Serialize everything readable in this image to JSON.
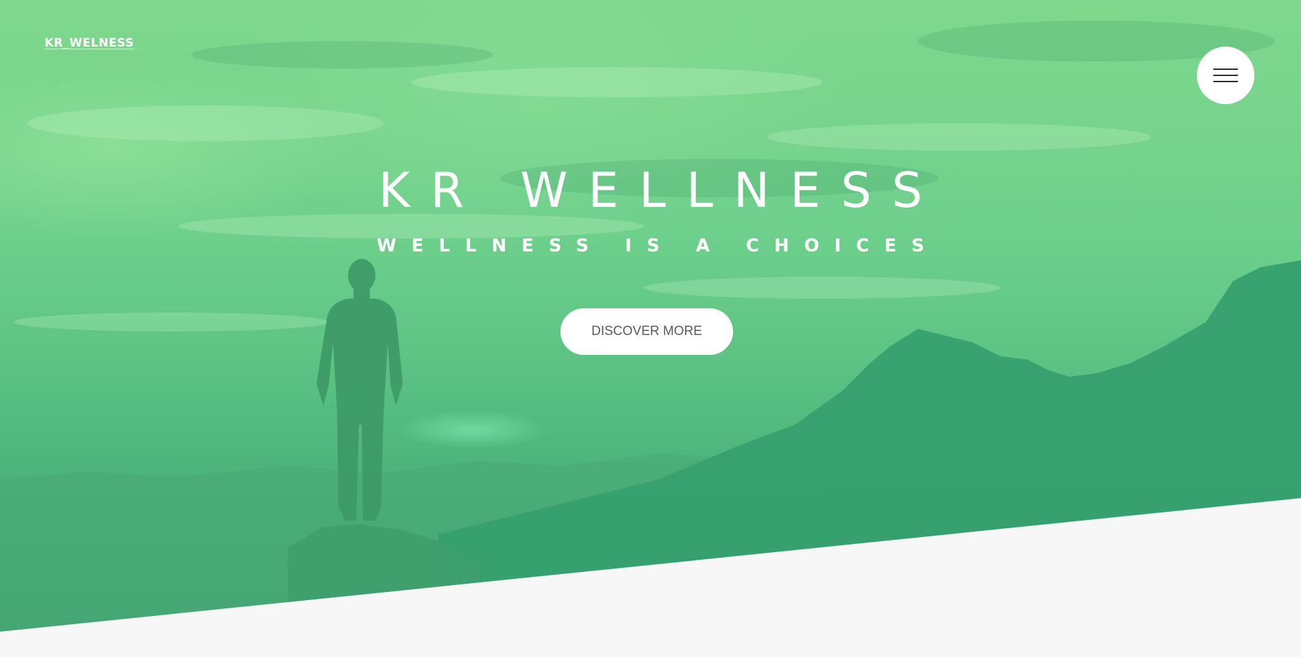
{
  "header": {
    "logo_text": "KR_WELNESS",
    "menu_icon": "hamburger-menu-icon"
  },
  "hero": {
    "title": "KR WELLNESS",
    "subtitle": "WELLNESS IS A CHOICES",
    "cta_label": "DISCOVER MORE",
    "background_image": "person-on-mountain-silhouette",
    "overlay_color": "#4bbf7f",
    "lower_section_color": "#f7f7f7"
  }
}
